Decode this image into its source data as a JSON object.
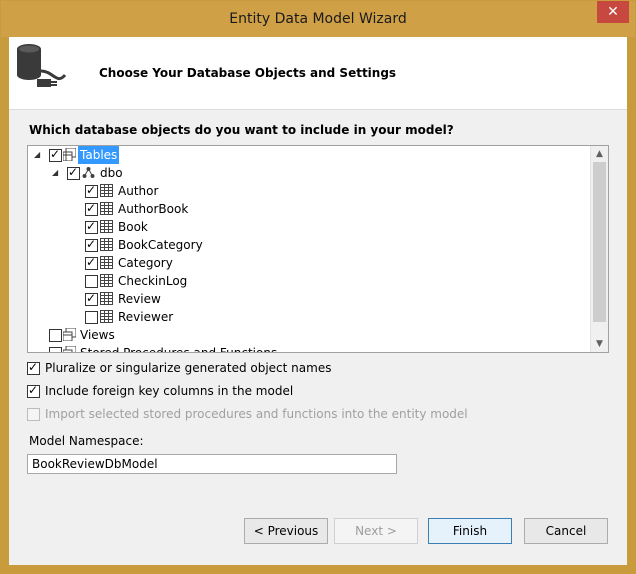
{
  "window": {
    "title": "Entity Data Model Wizard",
    "close_glyph": "✕"
  },
  "header": {
    "title": "Choose Your Database Objects and Settings",
    "icon": "database-plug-icon"
  },
  "question": "Which database objects do you want to include in your model?",
  "tree": {
    "tables": {
      "label": "Tables",
      "checked": true,
      "expanded": true,
      "selected": true
    },
    "schema": {
      "label": "dbo",
      "checked": true,
      "expanded": true
    },
    "items": [
      {
        "label": "Author",
        "checked": true
      },
      {
        "label": "AuthorBook",
        "checked": true
      },
      {
        "label": "Book",
        "checked": true
      },
      {
        "label": "BookCategory",
        "checked": true
      },
      {
        "label": "Category",
        "checked": true
      },
      {
        "label": "CheckinLog",
        "checked": false
      },
      {
        "label": "Review",
        "checked": true
      },
      {
        "label": "Reviewer",
        "checked": false
      }
    ],
    "views": {
      "label": "Views",
      "checked": false
    },
    "procs": {
      "label": "Stored Procedures and Functions",
      "checked": false
    }
  },
  "options": {
    "pluralize": {
      "label": "Pluralize or singularize generated object names",
      "checked": true
    },
    "foreign_keys": {
      "label": "Include foreign key columns in the model",
      "checked": true
    },
    "import_procs": {
      "label": "Import selected stored procedures and functions into the entity model",
      "checked": false,
      "disabled": true
    }
  },
  "namespace": {
    "label": "Model Namespace:",
    "value": "BookReviewDbModel"
  },
  "buttons": {
    "previous": "< Previous",
    "next": "Next >",
    "finish": "Finish",
    "cancel": "Cancel"
  },
  "colors": {
    "title_bar": "#cfa046",
    "close_button": "#c7483f",
    "selection": "#3399ff"
  }
}
